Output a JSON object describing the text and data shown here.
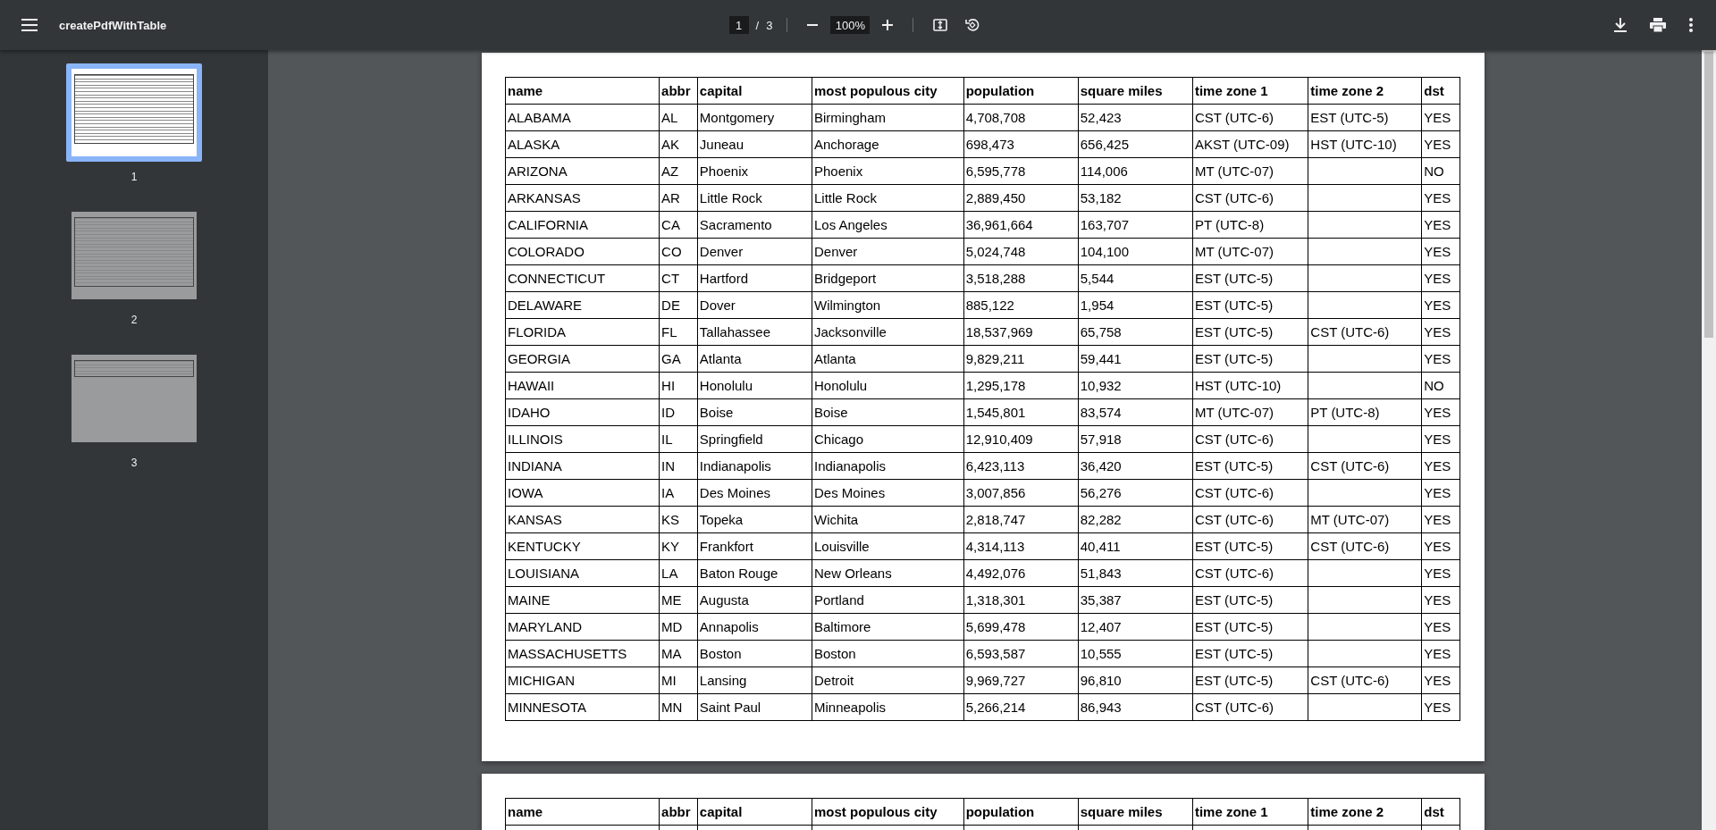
{
  "toolbar": {
    "title": "createPdfWithTable",
    "page_current": "1",
    "page_separator": "/",
    "page_total": "3",
    "zoom": "100%"
  },
  "thumbnails": [
    {
      "label": "1",
      "selected": true,
      "kind": "full"
    },
    {
      "label": "2",
      "selected": false,
      "kind": "full"
    },
    {
      "label": "3",
      "selected": false,
      "kind": "short"
    }
  ],
  "pages": [
    {
      "columns": [
        "name",
        "abbr",
        "capital",
        "most populous city",
        "population",
        "square miles",
        "time zone 1",
        "time zone 2",
        "dst"
      ],
      "rows": [
        {
          "name": "ALABAMA",
          "abbr": "AL",
          "capital": "Montgomery",
          "city": "Birmingham",
          "population": "4,708,708",
          "square_miles": "52,423",
          "tz1": "CST (UTC-6)",
          "tz2": "EST (UTC-5)",
          "dst": "YES"
        },
        {
          "name": "ALASKA",
          "abbr": "AK",
          "capital": "Juneau",
          "city": "Anchorage",
          "population": "698,473",
          "square_miles": "656,425",
          "tz1": "AKST (UTC-09)",
          "tz2": "HST (UTC-10)",
          "dst": "YES"
        },
        {
          "name": "ARIZONA",
          "abbr": "AZ",
          "capital": "Phoenix",
          "city": "Phoenix",
          "population": "6,595,778",
          "square_miles": "114,006",
          "tz1": "MT (UTC-07)",
          "dst": "NO"
        },
        {
          "name": "ARKANSAS",
          "abbr": "AR",
          "capital": "Little Rock",
          "city": "Little Rock",
          "population": "2,889,450",
          "square_miles": "53,182",
          "tz1": "CST (UTC-6)",
          "dst": "YES"
        },
        {
          "name": "CALIFORNIA",
          "abbr": "CA",
          "capital": "Sacramento",
          "city": "Los Angeles",
          "population": "36,961,664",
          "square_miles": "163,707",
          "tz1": "PT (UTC-8)",
          "dst": "YES"
        },
        {
          "name": "COLORADO",
          "abbr": "CO",
          "capital": "Denver",
          "city": "Denver",
          "population": "5,024,748",
          "square_miles": "104,100",
          "tz1": "MT (UTC-07)",
          "dst": "YES"
        },
        {
          "name": "CONNECTICUT",
          "abbr": "CT",
          "capital": "Hartford",
          "city": "Bridgeport",
          "population": "3,518,288",
          "square_miles": "5,544",
          "tz1": "EST (UTC-5)",
          "dst": "YES"
        },
        {
          "name": "DELAWARE",
          "abbr": "DE",
          "capital": "Dover",
          "city": "Wilmington",
          "population": "885,122",
          "square_miles": "1,954",
          "tz1": "EST (UTC-5)",
          "dst": "YES"
        },
        {
          "name": "FLORIDA",
          "abbr": "FL",
          "capital": "Tallahassee",
          "city": "Jacksonville",
          "population": "18,537,969",
          "square_miles": "65,758",
          "tz1": "EST (UTC-5)",
          "tz2": "CST (UTC-6)",
          "dst": "YES"
        },
        {
          "name": "GEORGIA",
          "abbr": "GA",
          "capital": "Atlanta",
          "city": "Atlanta",
          "population": "9,829,211",
          "square_miles": "59,441",
          "tz1": "EST (UTC-5)",
          "dst": "YES"
        },
        {
          "name": "HAWAII",
          "abbr": "HI",
          "capital": "Honolulu",
          "city": "Honolulu",
          "population": "1,295,178",
          "square_miles": "10,932",
          "tz1": "HST (UTC-10)",
          "dst": "NO"
        },
        {
          "name": "IDAHO",
          "abbr": "ID",
          "capital": "Boise",
          "city": "Boise",
          "population": "1,545,801",
          "square_miles": "83,574",
          "tz1": "MT (UTC-07)",
          "tz2": "PT (UTC-8)",
          "dst": "YES"
        },
        {
          "name": "ILLINOIS",
          "abbr": "IL",
          "capital": "Springfield",
          "city": "Chicago",
          "population": "12,910,409",
          "square_miles": "57,918",
          "tz1": "CST (UTC-6)",
          "dst": "YES"
        },
        {
          "name": "INDIANA",
          "abbr": "IN",
          "capital": "Indianapolis",
          "city": "Indianapolis",
          "population": "6,423,113",
          "square_miles": "36,420",
          "tz1": "EST (UTC-5)",
          "tz2": "CST (UTC-6)",
          "dst": "YES"
        },
        {
          "name": "IOWA",
          "abbr": "IA",
          "capital": "Des Moines",
          "city": "Des Moines",
          "population": "3,007,856",
          "square_miles": "56,276",
          "tz1": "CST (UTC-6)",
          "dst": "YES"
        },
        {
          "name": "KANSAS",
          "abbr": "KS",
          "capital": "Topeka",
          "city": "Wichita",
          "population": "2,818,747",
          "square_miles": "82,282",
          "tz1": "CST (UTC-6)",
          "tz2": "MT (UTC-07)",
          "dst": "YES"
        },
        {
          "name": "KENTUCKY",
          "abbr": "KY",
          "capital": "Frankfort",
          "city": "Louisville",
          "population": "4,314,113",
          "square_miles": "40,411",
          "tz1": "EST (UTC-5)",
          "tz2": "CST (UTC-6)",
          "dst": "YES"
        },
        {
          "name": "LOUISIANA",
          "abbr": "LA",
          "capital": "Baton Rouge",
          "city": "New Orleans",
          "population": "4,492,076",
          "square_miles": "51,843",
          "tz1": "CST (UTC-6)",
          "dst": "YES"
        },
        {
          "name": "MAINE",
          "abbr": "ME",
          "capital": "Augusta",
          "city": "Portland",
          "population": "1,318,301",
          "square_miles": "35,387",
          "tz1": "EST (UTC-5)",
          "dst": "YES"
        },
        {
          "name": "MARYLAND",
          "abbr": "MD",
          "capital": "Annapolis",
          "city": "Baltimore",
          "population": "5,699,478",
          "square_miles": "12,407",
          "tz1": "EST (UTC-5)",
          "dst": "YES"
        },
        {
          "name": "MASSACHUSETTS",
          "abbr": "MA",
          "capital": "Boston",
          "city": "Boston",
          "population": "6,593,587",
          "square_miles": "10,555",
          "tz1": "EST (UTC-5)",
          "dst": "YES"
        },
        {
          "name": "MICHIGAN",
          "abbr": "MI",
          "capital": "Lansing",
          "city": "Detroit",
          "population": "9,969,727",
          "square_miles": "96,810",
          "tz1": "EST (UTC-5)",
          "tz2": "CST (UTC-6)",
          "dst": "YES"
        },
        {
          "name": "MINNESOTA",
          "abbr": "MN",
          "capital": "Saint Paul",
          "city": "Minneapolis",
          "population": "5,266,214",
          "square_miles": "86,943",
          "tz1": "CST (UTC-6)",
          "dst": "YES"
        }
      ]
    },
    {
      "columns": [
        "name",
        "abbr",
        "capital",
        "most populous city",
        "population",
        "square miles",
        "time zone 1",
        "time zone 2",
        "dst"
      ]
    }
  ]
}
